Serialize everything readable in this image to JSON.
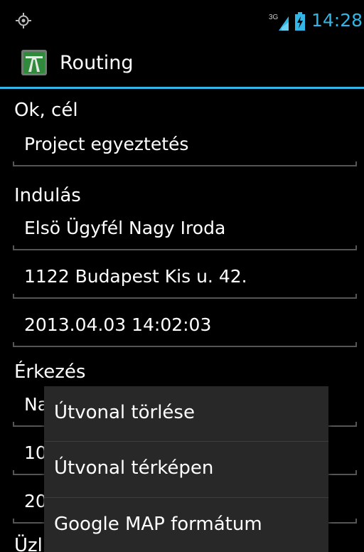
{
  "status_bar": {
    "time": "14:28",
    "network_label": "3G",
    "icons": [
      "gps-icon",
      "signal-3g-icon",
      "battery-charging-icon"
    ],
    "accent_color": "#33b5e5"
  },
  "action_bar": {
    "title": "Routing",
    "app_icon": "motorway-icon"
  },
  "form": {
    "goal_label": "Ok, cél",
    "goal_value": "Project egyeztetés",
    "departure_label": "Indulás",
    "departure_name": "Elsö Ügyfél Nagy Iroda",
    "departure_address": "1122 Budapest Kis u. 42.",
    "departure_time": "2013.04.03 14:02:03",
    "arrival_label": "Érkezés",
    "arrival_name_partial": "Na",
    "arrival_address_partial": "10",
    "arrival_time_partial": "20",
    "partner_label_partial": "Üzl"
  },
  "context_menu": {
    "items": [
      {
        "label": "Útvonal törlése"
      },
      {
        "label": "Útvonal térképen"
      },
      {
        "label": "Google MAP formátum"
      }
    ]
  }
}
